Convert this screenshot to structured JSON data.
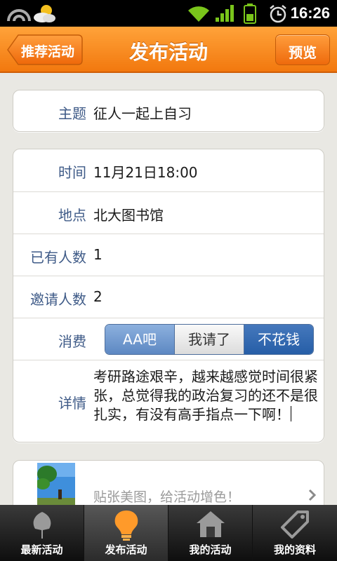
{
  "status_bar": {
    "time": "16:26"
  },
  "header": {
    "back_label": "推荐活动",
    "title": "发布活动",
    "preview_label": "预览"
  },
  "subject": {
    "label": "主题",
    "value": "征人一起上自习"
  },
  "details": [
    {
      "label": "时间",
      "value": "11月21日18:00"
    },
    {
      "label": "地点",
      "value": "北大图书馆"
    },
    {
      "label": "已有人数",
      "value": "1"
    },
    {
      "label": "邀请人数",
      "value": "2"
    }
  ],
  "expense": {
    "label": "消费",
    "options": [
      "AA吧",
      "我请了",
      "不花钱"
    ],
    "selected": "不花钱"
  },
  "description": {
    "label": "详情",
    "value": "考研路途艰辛，越来越感觉时间很紧张，总觉得我的政治复习的还不是很扎实，有没有高手指点一下啊！"
  },
  "photo": {
    "hint": "贴张美图，给活动增色！"
  },
  "tabs": [
    {
      "label": "最新活动",
      "icon": "leaf-icon"
    },
    {
      "label": "发布活动",
      "icon": "lightbulb-icon",
      "active": true
    },
    {
      "label": "我的活动",
      "icon": "house-icon"
    },
    {
      "label": "我的资料",
      "icon": "tag-icon"
    }
  ],
  "colors": {
    "header_orange": "#f58a1f",
    "segment_blue": "#2f67b0",
    "label_blue": "#3e5a87"
  }
}
